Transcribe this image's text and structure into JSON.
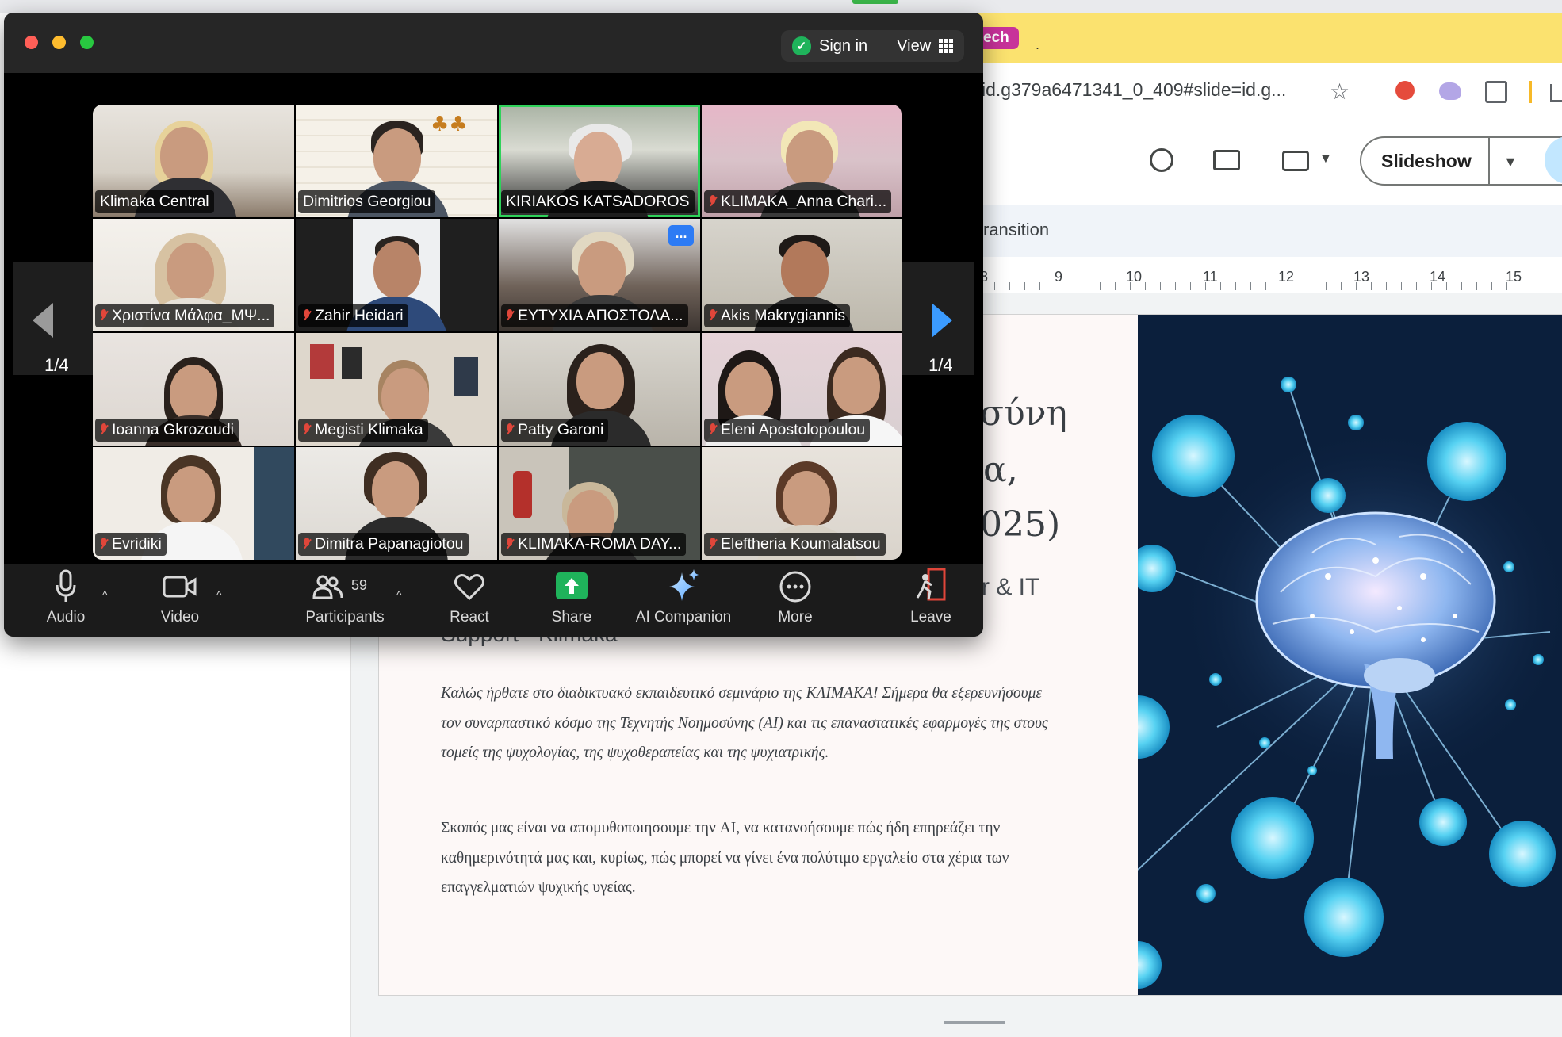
{
  "browser": {
    "tab_label": "ech",
    "tab_extra": ".",
    "url": "id.g379a6471341_0_409#slide=id.g...",
    "colors": {
      "tab_strip": "#fbe26f",
      "tab_chip": "#c8329a"
    }
  },
  "slides_app": {
    "slideshow_label": "Slideshow",
    "transition_label": "ransition",
    "ruler_numbers": [
      "8",
      "9",
      "10",
      "11",
      "12",
      "13",
      "14",
      "15"
    ],
    "slide": {
      "title_lines": [
        "σύνη",
        "α,",
        "025)"
      ],
      "subtitle_fragment": "r & IT",
      "subtitle_line2": "Support - Klimaka",
      "paragraph_1": "Καλώς ήρθατε στο διαδικτυακό εκπαιδευτικό σεμινάριο της ΚΛΙΜΑΚΑ! Σήμερα θα εξερευνήσουμε τον συναρπαστικό κόσμο της Τεχνητής Νοημοσύνης (AI) και τις επαναστατικές εφαρμογές της στους τομείς της ψυχολογίας, της ψυχοθεραπείας και της ψυχιατρικής.",
      "paragraph_2": "Σκοπός μας είναι να απομυθοποιησουμε την AI, να κατανοήσουμε πώς ήδη επηρεάζει την καθημερινότητά μας και, κυρίως, πώς μπορεί να γίνει ένα πολύτιμο εργαλείο στα χέρια των επαγγελματιών ψυχικής υγείας."
    }
  },
  "zoom": {
    "header": {
      "sign_in": "Sign in",
      "view": "View",
      "shield_icon": "shield-check-icon"
    },
    "pagination": {
      "left_label": "1/4",
      "right_label": "1/4",
      "right_arrow_color": "#3b9bff"
    },
    "participants": [
      {
        "name": "Klimaka Central",
        "muted": false,
        "active": false
      },
      {
        "name": "Dimitrios Georgiou",
        "muted": false,
        "active": false
      },
      {
        "name": "KIRIAKOS KATSADOROS",
        "muted": false,
        "active": true
      },
      {
        "name": "KLIMAKA_Anna Chari...",
        "muted": true,
        "active": false
      },
      {
        "name": "Χριστίνα Μάλφα_ΜΨ...",
        "muted": true,
        "active": false
      },
      {
        "name": "Zahir Heidari",
        "muted": true,
        "active": false
      },
      {
        "name": "ΕΥΤΥΧΙΑ ΑΠΟΣΤΟΛΑ...",
        "muted": true,
        "active": false
      },
      {
        "name": "Akis Makrygiannis",
        "muted": true,
        "active": false
      },
      {
        "name": "Ioanna Gkrozoudi",
        "muted": true,
        "active": false
      },
      {
        "name": "Megisti Klimaka",
        "muted": true,
        "active": false
      },
      {
        "name": "Patty Garoni",
        "muted": true,
        "active": false
      },
      {
        "name": "Eleni Apostolopoulou",
        "muted": true,
        "active": false
      },
      {
        "name": "Evridiki",
        "muted": true,
        "active": false
      },
      {
        "name": "Dimitra Papanagiotou",
        "muted": true,
        "active": false
      },
      {
        "name": "KLIMAKA-ROMA DAY...",
        "muted": true,
        "active": false
      },
      {
        "name": "Eleftheria Koumalatsou",
        "muted": true,
        "active": false
      }
    ],
    "active_speaker_color": "#2fd25a",
    "tile_more_icon": "...",
    "toolbar": {
      "audio": "Audio",
      "video": "Video",
      "participants": "Participants",
      "participants_count": "59",
      "react": "React",
      "share": "Share",
      "ai_companion": "AI Companion",
      "more": "More",
      "leave": "Leave",
      "share_color": "#1fb35b"
    }
  }
}
